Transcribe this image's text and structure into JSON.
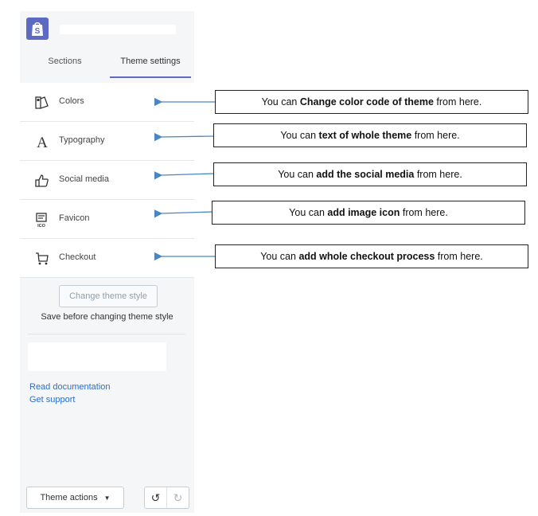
{
  "sidebar": {
    "tabs": [
      {
        "label": "Sections"
      },
      {
        "label": "Theme settings"
      }
    ],
    "menu": [
      {
        "label": "Colors",
        "icon": "colors-icon"
      },
      {
        "label": "Typography",
        "icon": "typography-icon"
      },
      {
        "label": "Social media",
        "icon": "thumbs-up-icon"
      },
      {
        "label": "Favicon",
        "icon": "favicon-icon"
      },
      {
        "label": "Checkout",
        "icon": "cart-icon"
      }
    ],
    "change_theme_button": "Change theme style",
    "save_note": "Save before changing theme style",
    "links": {
      "read_docs": "Read documentation",
      "get_support": "Get support"
    },
    "bottom": {
      "theme_actions": "Theme actions"
    }
  },
  "annotations": [
    {
      "pre": "You can ",
      "bold": "Change color code of theme",
      "post": " from here."
    },
    {
      "pre": "You can ",
      "bold": "text of whole theme",
      "post": " from here."
    },
    {
      "pre": "You can ",
      "bold": "add the social media",
      "post": " from here."
    },
    {
      "pre": "You can ",
      "bold": "add image icon",
      "post": " from here."
    },
    {
      "pre": "You can ",
      "bold": "add whole checkout process",
      "post": " from here."
    }
  ],
  "colors": {
    "accent": "#5c6ac4",
    "link": "#2c6ecb",
    "arrow": "#4a86c5"
  }
}
